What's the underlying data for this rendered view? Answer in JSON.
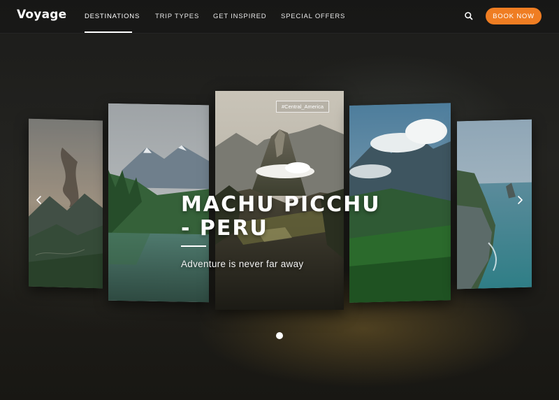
{
  "header": {
    "logo": "Voyage",
    "nav": [
      {
        "label": "DESTINATIONS",
        "active": true
      },
      {
        "label": "TRIP TYPES",
        "active": false
      },
      {
        "label": "GET INSPIRED",
        "active": false
      },
      {
        "label": "SPECIAL OFFERS",
        "active": false
      }
    ],
    "search_icon": "search-icon",
    "book_label": "BOOK NOW"
  },
  "hero": {
    "tag": "#Central_America",
    "title_line1": "MACHU PICCHU",
    "title_line2": "- PERU",
    "subtitle": "Adventure is never far away"
  },
  "carousel": {
    "cards": [
      "volcano-valley",
      "mountain-lake",
      "machu-picchu",
      "misty-peaks",
      "coastal-cliffs"
    ],
    "active_index": 2,
    "dots": 1,
    "prev_icon": "chevron-left-icon",
    "next_icon": "chevron-right-icon"
  },
  "colors": {
    "accent": "#ef7d22",
    "header_bg": "#1a1a1a",
    "text": "#ffffff"
  }
}
